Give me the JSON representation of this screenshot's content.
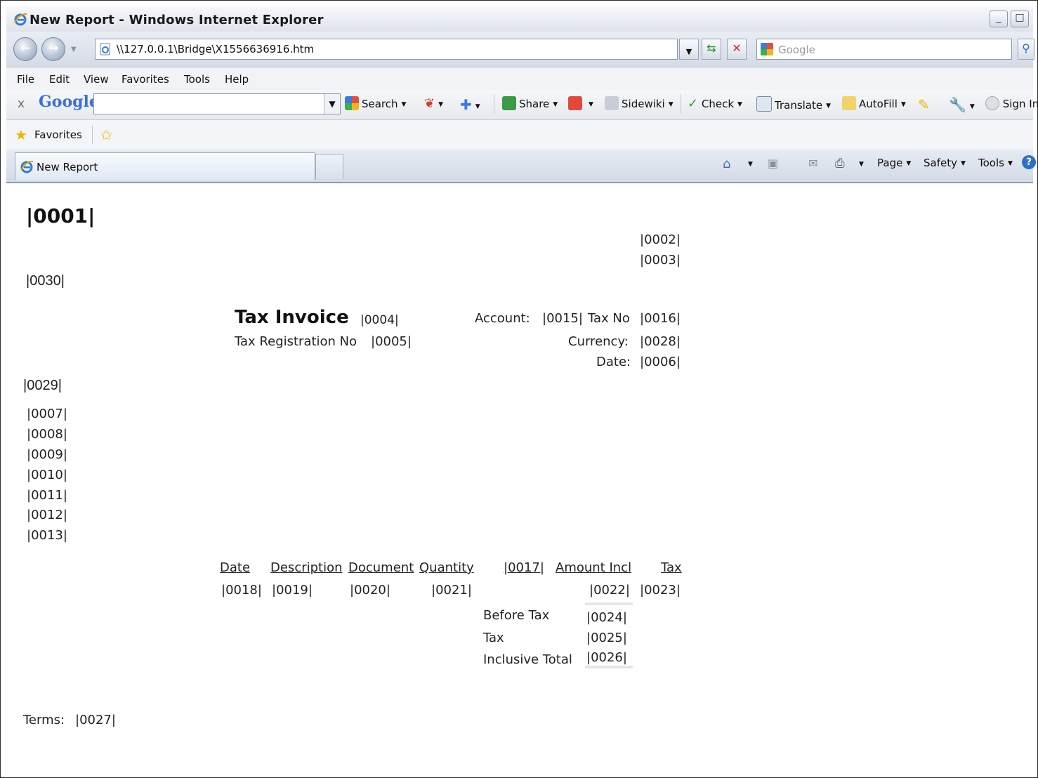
{
  "window": {
    "title": "New Report - Windows Internet Explorer",
    "minimize_glyph": "_",
    "maximize_glyph": "□"
  },
  "address": {
    "url": "\\\\127.0.0.1\\Bridge\\X1556636916.htm",
    "search_placeholder": "Google"
  },
  "menu": [
    "File",
    "Edit",
    "View",
    "Favorites",
    "Tools",
    "Help"
  ],
  "google_toolbar": {
    "close": "x",
    "logo": "Google",
    "search": "Search",
    "share": "Share",
    "sidewiki": "Sidewiki",
    "check": "Check",
    "translate": "Translate",
    "autofill": "AutoFill",
    "sign_in": "Sign In"
  },
  "favorites": {
    "label": "Favorites"
  },
  "tab": {
    "label": "New Report"
  },
  "command_bar": {
    "page": "Page",
    "safety": "Safety",
    "tools": "Tools"
  },
  "report": {
    "heading": "|0001|",
    "field_0002": "|0002|",
    "field_0003": "|0003|",
    "field_0030": "|0030|",
    "invoice_title": "Tax Invoice",
    "field_0004": "|0004|",
    "tax_reg_label": "Tax Registration No",
    "field_0005": "|0005|",
    "account_label": "Account:",
    "field_0015": "|0015|",
    "tax_no_label": "Tax No",
    "field_0016": "|0016|",
    "currency_label": "Currency:",
    "field_0028": "|0028|",
    "date_label": "Date:",
    "field_0006": "|0006|",
    "field_0029": "|0029|",
    "address_lines": [
      "|0007|",
      "|0008|",
      "|0009|",
      "|0010|",
      "|0011|",
      "|0012|",
      "|0013|"
    ],
    "table_headers": {
      "date": "Date",
      "description": "Description",
      "document": "Document",
      "quantity": "Quantity",
      "col_0017": "|0017|",
      "amount_incl": "Amount Incl",
      "tax": "Tax"
    },
    "table_row": {
      "date": "|0018|",
      "description": "|0019|",
      "document": "|0020|",
      "quantity": "|0021|",
      "amount_incl": "|0022|",
      "tax": "|0023|"
    },
    "totals": [
      {
        "label": "Before Tax",
        "value": "|0024|"
      },
      {
        "label": "Tax",
        "value": "|0025|"
      },
      {
        "label": "Inclusive Total",
        "value": "|0026|"
      }
    ],
    "terms_label": "Terms:",
    "field_0027": "|0027|"
  }
}
